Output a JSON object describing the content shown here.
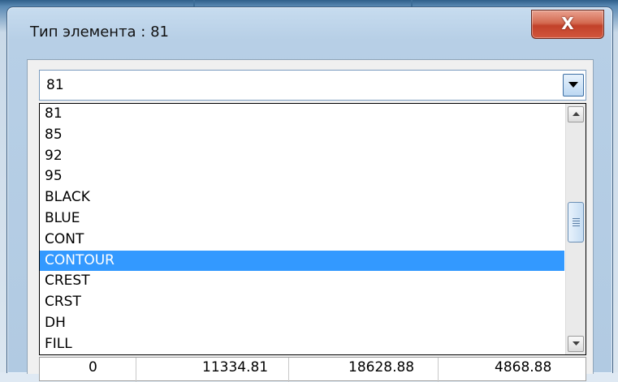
{
  "window": {
    "title": "Тип элемента : 81",
    "close_label": "X"
  },
  "combo": {
    "value": "81"
  },
  "list": {
    "items": [
      "81",
      "85",
      "92",
      "95",
      "BLACK",
      "BLUE",
      "CONT",
      "CONTOUR",
      "CREST",
      "CRST",
      "DH",
      "FILL"
    ],
    "selected": "CONTOUR"
  },
  "table_row": {
    "cells": [
      "0",
      "11334.81",
      "18628.88",
      "4868.88"
    ]
  },
  "colors": {
    "selection": "#3399ff",
    "close_button": "#c2412a",
    "title_bar": "#c7dcef"
  }
}
